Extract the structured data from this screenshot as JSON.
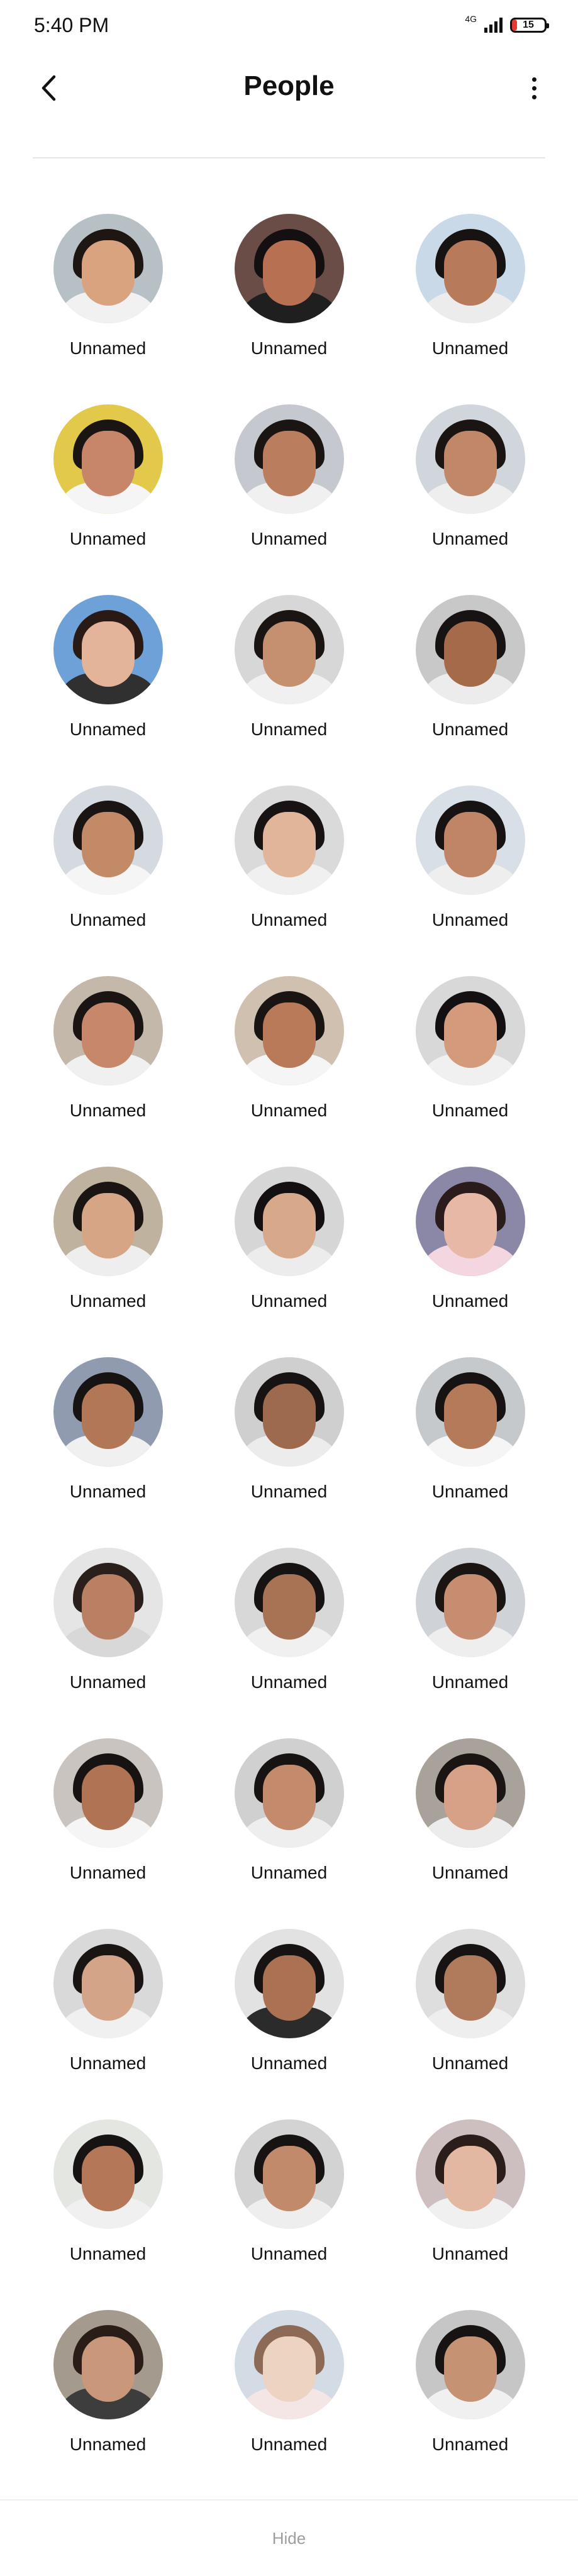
{
  "status_bar": {
    "time": "5:40 PM",
    "network": "4G",
    "battery": {
      "text": "15",
      "level": 0.15,
      "level_color": "#e53935"
    }
  },
  "header": {
    "title": "People",
    "back_icon": "chevron-left-icon",
    "more_icon": "vertical-dots-icon"
  },
  "people": [
    {
      "label": "Unnamed",
      "bg": "#b7c0c4",
      "skin": "#d9a37f",
      "hair": "#1d1612",
      "shirt": "#f1f1f1"
    },
    {
      "label": "Unnamed",
      "bg": "#6b4d47",
      "skin": "#b77052",
      "hair": "#141012",
      "shirt": "#1f1f1f"
    },
    {
      "label": "Unnamed",
      "bg": "#c9d9e8",
      "skin": "#b77b5c",
      "hair": "#171312",
      "shirt": "#ececec"
    },
    {
      "label": "Unnamed",
      "bg": "#e3c94a",
      "skin": "#c7866a",
      "hair": "#1a1412",
      "shirt": "#f5f5f5"
    },
    {
      "label": "Unnamed",
      "bg": "#c5c9cf",
      "skin": "#ba7d5e",
      "hair": "#1a1412",
      "shirt": "#f0f0f0"
    },
    {
      "label": "Unnamed",
      "bg": "#d0d6dc",
      "skin": "#c08868",
      "hair": "#1a1412",
      "shirt": "#eeeeee"
    },
    {
      "label": "Unnamed",
      "bg": "#6fa1d9",
      "skin": "#e3b39a",
      "hair": "#2a1a16",
      "shirt": "#303030"
    },
    {
      "label": "Unnamed",
      "bg": "#d7d7d7",
      "skin": "#c4906f",
      "hair": "#1a1412",
      "shirt": "#f0f0f0"
    },
    {
      "label": "Unnamed",
      "bg": "#c8c8c8",
      "skin": "#a56a4a",
      "hair": "#171312",
      "shirt": "#ececec"
    },
    {
      "label": "Unnamed",
      "bg": "#d5dae0",
      "skin": "#c38a68",
      "hair": "#1a1412",
      "shirt": "#f5f5f5"
    },
    {
      "label": "Unnamed",
      "bg": "#dadada",
      "skin": "#e0b59a",
      "hair": "#171312",
      "shirt": "#f0f0f0"
    },
    {
      "label": "Unnamed",
      "bg": "#d9dfe6",
      "skin": "#c08567",
      "hair": "#171312",
      "shirt": "#eeeeee"
    },
    {
      "label": "Unnamed",
      "bg": "#c4b8ab",
      "skin": "#c7876a",
      "hair": "#1a1412",
      "shirt": "#f0f0f0"
    },
    {
      "label": "Unnamed",
      "bg": "#d0c0b0",
      "skin": "#b97a5a",
      "hair": "#1a1412",
      "shirt": "#f5f5f5"
    },
    {
      "label": "Unnamed",
      "bg": "#d8d8d8",
      "skin": "#d39b7c",
      "hair": "#141012",
      "shirt": "#f0f0f0"
    },
    {
      "label": "Unnamed",
      "bg": "#bfb39f",
      "skin": "#d6a586",
      "hair": "#1a1412",
      "shirt": "#eeeeee"
    },
    {
      "label": "Unnamed",
      "bg": "#d6d6d6",
      "skin": "#d7a88a",
      "hair": "#141012",
      "shirt": "#ececec"
    },
    {
      "label": "Unnamed",
      "bg": "#8a88a6",
      "skin": "#e8b8a6",
      "hair": "#2a1c1a",
      "shirt": "#f3d6e0"
    },
    {
      "label": "Unnamed",
      "bg": "#909bb0",
      "skin": "#b27756",
      "hair": "#171312",
      "shirt": "#f0f0f0"
    },
    {
      "label": "Unnamed",
      "bg": "#cfcfcf",
      "skin": "#9e6a4e",
      "hair": "#171312",
      "shirt": "#ececec"
    },
    {
      "label": "Unnamed",
      "bg": "#c6c9cc",
      "skin": "#b57a5a",
      "hair": "#171312",
      "shirt": "#f5f5f5"
    },
    {
      "label": "Unnamed",
      "bg": "#e5e5e5",
      "skin": "#b98063",
      "hair": "#2a1f1a",
      "shirt": "#d8d8d8"
    },
    {
      "label": "Unnamed",
      "bg": "#d8d8d8",
      "skin": "#a87355",
      "hair": "#171312",
      "shirt": "#f0f0f0"
    },
    {
      "label": "Unnamed",
      "bg": "#cfd3d8",
      "skin": "#c68d70",
      "hair": "#1a1412",
      "shirt": "#eeeeee"
    },
    {
      "label": "Unnamed",
      "bg": "#c9c4bf",
      "skin": "#b07455",
      "hair": "#171312",
      "shirt": "#f5f5f5"
    },
    {
      "label": "Unnamed",
      "bg": "#d0d0d0",
      "skin": "#c48a6c",
      "hair": "#171312",
      "shirt": "#eeeeee"
    },
    {
      "label": "Unnamed",
      "bg": "#a8a29b",
      "skin": "#d6a186",
      "hair": "#1a1412",
      "shirt": "#ececec"
    },
    {
      "label": "Unnamed",
      "bg": "#d9d9d9",
      "skin": "#d3a487",
      "hair": "#1a1412",
      "shirt": "#f0f0f0"
    },
    {
      "label": "Unnamed",
      "bg": "#e2e2e2",
      "skin": "#aa7253",
      "hair": "#171312",
      "shirt": "#2b2b2b"
    },
    {
      "label": "Unnamed",
      "bg": "#dedede",
      "skin": "#b07a5c",
      "hair": "#171312",
      "shirt": "#eeeeee"
    },
    {
      "label": "Unnamed",
      "bg": "#e4e6e2",
      "skin": "#b47758",
      "hair": "#171312",
      "shirt": "#f0f0f0"
    },
    {
      "label": "Unnamed",
      "bg": "#d3d3d3",
      "skin": "#c18a6b",
      "hair": "#171312",
      "shirt": "#eeeeee"
    },
    {
      "label": "Unnamed",
      "bg": "#cdbfbf",
      "skin": "#e2b8a3",
      "hair": "#2b1d1a",
      "shirt": "#f0f0f0"
    },
    {
      "label": "Unnamed",
      "bg": "#a49a8e",
      "skin": "#c99779",
      "hair": "#2a1d18",
      "shirt": "#3d3d3d"
    },
    {
      "label": "Unnamed",
      "bg": "#d3dce4",
      "skin": "#edd3c2",
      "hair": "#8c6a55",
      "shirt": "#f5e6e6"
    },
    {
      "label": "Unnamed",
      "bg": "#c6c6c6",
      "skin": "#c59274",
      "hair": "#171312",
      "shirt": "#f0f0f0"
    }
  ],
  "footer": {
    "hide_label": "Hide"
  }
}
